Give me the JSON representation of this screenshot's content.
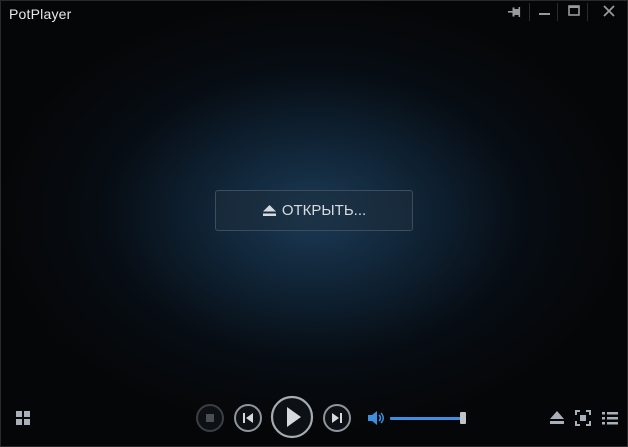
{
  "window": {
    "title": "PotPlayer"
  },
  "main": {
    "open_label": "ОТКРЫТЬ..."
  },
  "controls": {
    "volume_level": 0.98
  },
  "colors": {
    "accent": "#3d8fe0",
    "background_glow": "#1b3a56"
  },
  "icons": {
    "titlebar": [
      "pin-icon",
      "minimize-icon",
      "maximize-icon",
      "close-icon"
    ],
    "playback": [
      "stop-icon",
      "previous-icon",
      "play-icon",
      "next-icon",
      "speaker-icon"
    ],
    "right": [
      "eject-icon",
      "fullscreen-icon",
      "playlist-icon"
    ],
    "left": [
      "grid-menu-icon"
    ]
  }
}
